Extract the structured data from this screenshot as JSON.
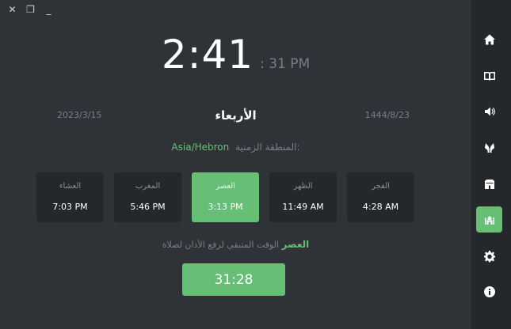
{
  "window": {
    "close_glyph": "✕",
    "restore_glyph": "❐",
    "minimize_glyph": "_"
  },
  "clock": {
    "time": "2:41",
    "seconds_period": ": 31 PM"
  },
  "dates": {
    "gregorian": "2023/3/15",
    "day_name": "الأربعاء",
    "hijri": "1444/8/23"
  },
  "timezone": {
    "label": "المنطقة الزمنية:",
    "value": "Asia/Hebron"
  },
  "prayers": [
    {
      "name": "العشاء",
      "time": "7:03 PM",
      "active": false
    },
    {
      "name": "المغرب",
      "time": "5:46 PM",
      "active": false
    },
    {
      "name": "العصر",
      "time": "3:13 PM",
      "active": true
    },
    {
      "name": "الظهر",
      "time": "11:49 AM",
      "active": false
    },
    {
      "name": "الفجر",
      "time": "4:28 AM",
      "active": false
    }
  ],
  "remaining": {
    "label": "الوقت المتبقي لرفع الأذان لصلاة",
    "prayer": "العصر"
  },
  "countdown": "31:28",
  "colors": {
    "accent": "#67bf76",
    "background": "#2f3337",
    "card": "#25282b",
    "sidebar": "#25282b",
    "muted_text": "#7a7f85"
  },
  "sidebar": {
    "items": [
      {
        "icon": "home-icon",
        "active": false
      },
      {
        "icon": "quran-book-icon",
        "active": false
      },
      {
        "icon": "speaker-icon",
        "active": false
      },
      {
        "icon": "praying-hands-icon",
        "active": false
      },
      {
        "icon": "kaaba-icon",
        "active": false
      },
      {
        "icon": "mosque-icon",
        "active": true
      },
      {
        "icon": "gear-icon",
        "active": false
      },
      {
        "icon": "info-icon",
        "active": false
      }
    ]
  }
}
